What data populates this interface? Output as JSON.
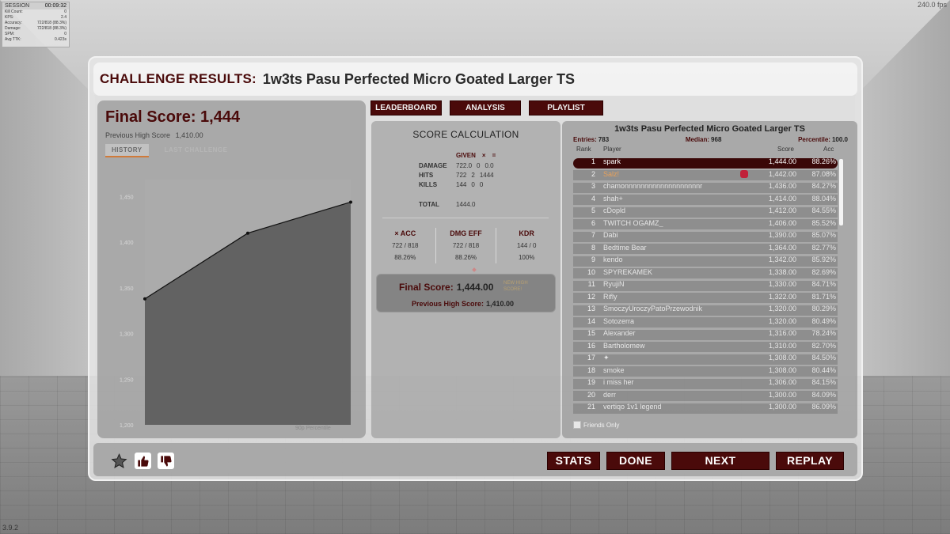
{
  "hud": {
    "session_label": "SESSION",
    "session_time": "00:09:32",
    "stats": [
      {
        "label": "Kill Count:",
        "value": "0"
      },
      {
        "label": "KPS:",
        "value": "2.4"
      },
      {
        "label": "Accuracy:",
        "value": "722/818 (88.3%)"
      },
      {
        "label": "Damage:",
        "value": "722/818 (88.3%)"
      },
      {
        "label": "SPM:",
        "value": "0"
      },
      {
        "label": "Avg TTK:",
        "value": "0.423s"
      }
    ],
    "fps": "240.0 fps",
    "version": "3.9.2"
  },
  "title": {
    "label": "CHALLENGE RESULTS:",
    "scenario": "1w3ts Pasu Perfected Micro Goated Larger TS"
  },
  "score": {
    "final": "Final Score: 1,444",
    "previous_label": "Previous High Score",
    "previous_value": "1,410.00",
    "tabs": [
      "HISTORY",
      "LAST CHALLENGE"
    ],
    "percentile_note": "90p Percentile"
  },
  "chart_data": {
    "type": "area",
    "x": [
      1,
      2,
      3
    ],
    "values": [
      1338,
      1410,
      1444
    ],
    "ylim": [
      1200,
      1460
    ],
    "yticks": [
      "1,450",
      "1,400",
      "1,350",
      "1,300",
      "1,250",
      "1,200"
    ],
    "xlabel": "",
    "ylabel": "",
    "title": ""
  },
  "nav_tabs": [
    "LEADERBOARD",
    "ANALYSIS",
    "PLAYLIST"
  ],
  "calc": {
    "title": "SCORE CALCULATION",
    "headers": [
      "GIVEN",
      "×",
      "="
    ],
    "rows": [
      {
        "label": "DAMAGE",
        "given": "722.0",
        "mult": "0",
        "result": "0.0"
      },
      {
        "label": "HITS",
        "given": "722",
        "mult": "2",
        "result": "1444"
      },
      {
        "label": "KILLS",
        "given": "144",
        "mult": "0",
        "result": "0"
      }
    ],
    "total_label": "TOTAL",
    "total_value": "1444.0",
    "stats": [
      {
        "header": "× ACC",
        "line1": "722 / 818",
        "line2": "88.26%"
      },
      {
        "header": "DMG EFF",
        "line1": "722 / 818",
        "line2": "88.26%"
      },
      {
        "header": "KDR",
        "line1": "144 / 0",
        "line2": "100%"
      }
    ],
    "final_label": "Final Score:",
    "final_value": "1,444.00",
    "new_high": "NEW HIGH SCORE!",
    "prev_label": "Previous High Score:",
    "prev_value": "1,410.00"
  },
  "leaderboard": {
    "title": "1w3ts Pasu Perfected Micro Goated Larger TS",
    "entries_label": "Entries:",
    "entries": "783",
    "median_label": "Median:",
    "median": "968",
    "percentile_label": "Percentile:",
    "percentile": "100.0",
    "columns": [
      "Rank",
      "Player",
      "Score",
      "Acc"
    ],
    "rows": [
      {
        "rank": "1",
        "player": "spark",
        "score": "1,444.00",
        "acc": "88.26%"
      },
      {
        "rank": "2",
        "player": "Salz!",
        "score": "1,442.00",
        "acc": "87.08%"
      },
      {
        "rank": "3",
        "player": "chamonnnnnnnnnnnnnnnnnnnr",
        "score": "1,436.00",
        "acc": "84.27%"
      },
      {
        "rank": "4",
        "player": "shah+",
        "score": "1,414.00",
        "acc": "88.04%"
      },
      {
        "rank": "5",
        "player": "cDopld",
        "score": "1,412.00",
        "acc": "84.55%"
      },
      {
        "rank": "6",
        "player": "TWITCH OGAMZ_",
        "score": "1,406.00",
        "acc": "85.52%"
      },
      {
        "rank": "7",
        "player": "Dabi",
        "score": "1,390.00",
        "acc": "85.07%"
      },
      {
        "rank": "8",
        "player": "Bedtime Bear",
        "score": "1,364.00",
        "acc": "82.77%"
      },
      {
        "rank": "9",
        "player": "kendo",
        "score": "1,342.00",
        "acc": "85.92%"
      },
      {
        "rank": "10",
        "player": "SPYREKAMEK",
        "score": "1,338.00",
        "acc": "82.69%"
      },
      {
        "rank": "11",
        "player": "RyujiN",
        "score": "1,330.00",
        "acc": "84.71%"
      },
      {
        "rank": "12",
        "player": "Rifly",
        "score": "1,322.00",
        "acc": "81.71%"
      },
      {
        "rank": "13",
        "player": "SmoczyUroczyPatoPrzewodnik",
        "score": "1,320.00",
        "acc": "80.29%"
      },
      {
        "rank": "14",
        "player": "Sotozerra",
        "score": "1,320.00",
        "acc": "80.49%"
      },
      {
        "rank": "15",
        "player": "Alexander",
        "score": "1,316.00",
        "acc": "78.24%"
      },
      {
        "rank": "16",
        "player": "Bartholomew",
        "score": "1,310.00",
        "acc": "82.70%"
      },
      {
        "rank": "17",
        "player": "✦",
        "score": "1,308.00",
        "acc": "84.50%"
      },
      {
        "rank": "18",
        "player": "smoke",
        "score": "1,308.00",
        "acc": "80.44%"
      },
      {
        "rank": "19",
        "player": "i miss her",
        "score": "1,306.00",
        "acc": "84.15%"
      },
      {
        "rank": "20",
        "player": "derr",
        "score": "1,300.00",
        "acc": "84.09%"
      },
      {
        "rank": "21",
        "player": "vertiqo 1v1 legend",
        "score": "1,300.00",
        "acc": "86.09%"
      }
    ],
    "friends_only": "Friends Only"
  },
  "footer": {
    "buttons": [
      "STATS",
      "DONE",
      "NEXT",
      "REPLAY"
    ]
  },
  "colors": {
    "accent": "#4a0a0a",
    "highlight_player": "#e8a15a"
  }
}
